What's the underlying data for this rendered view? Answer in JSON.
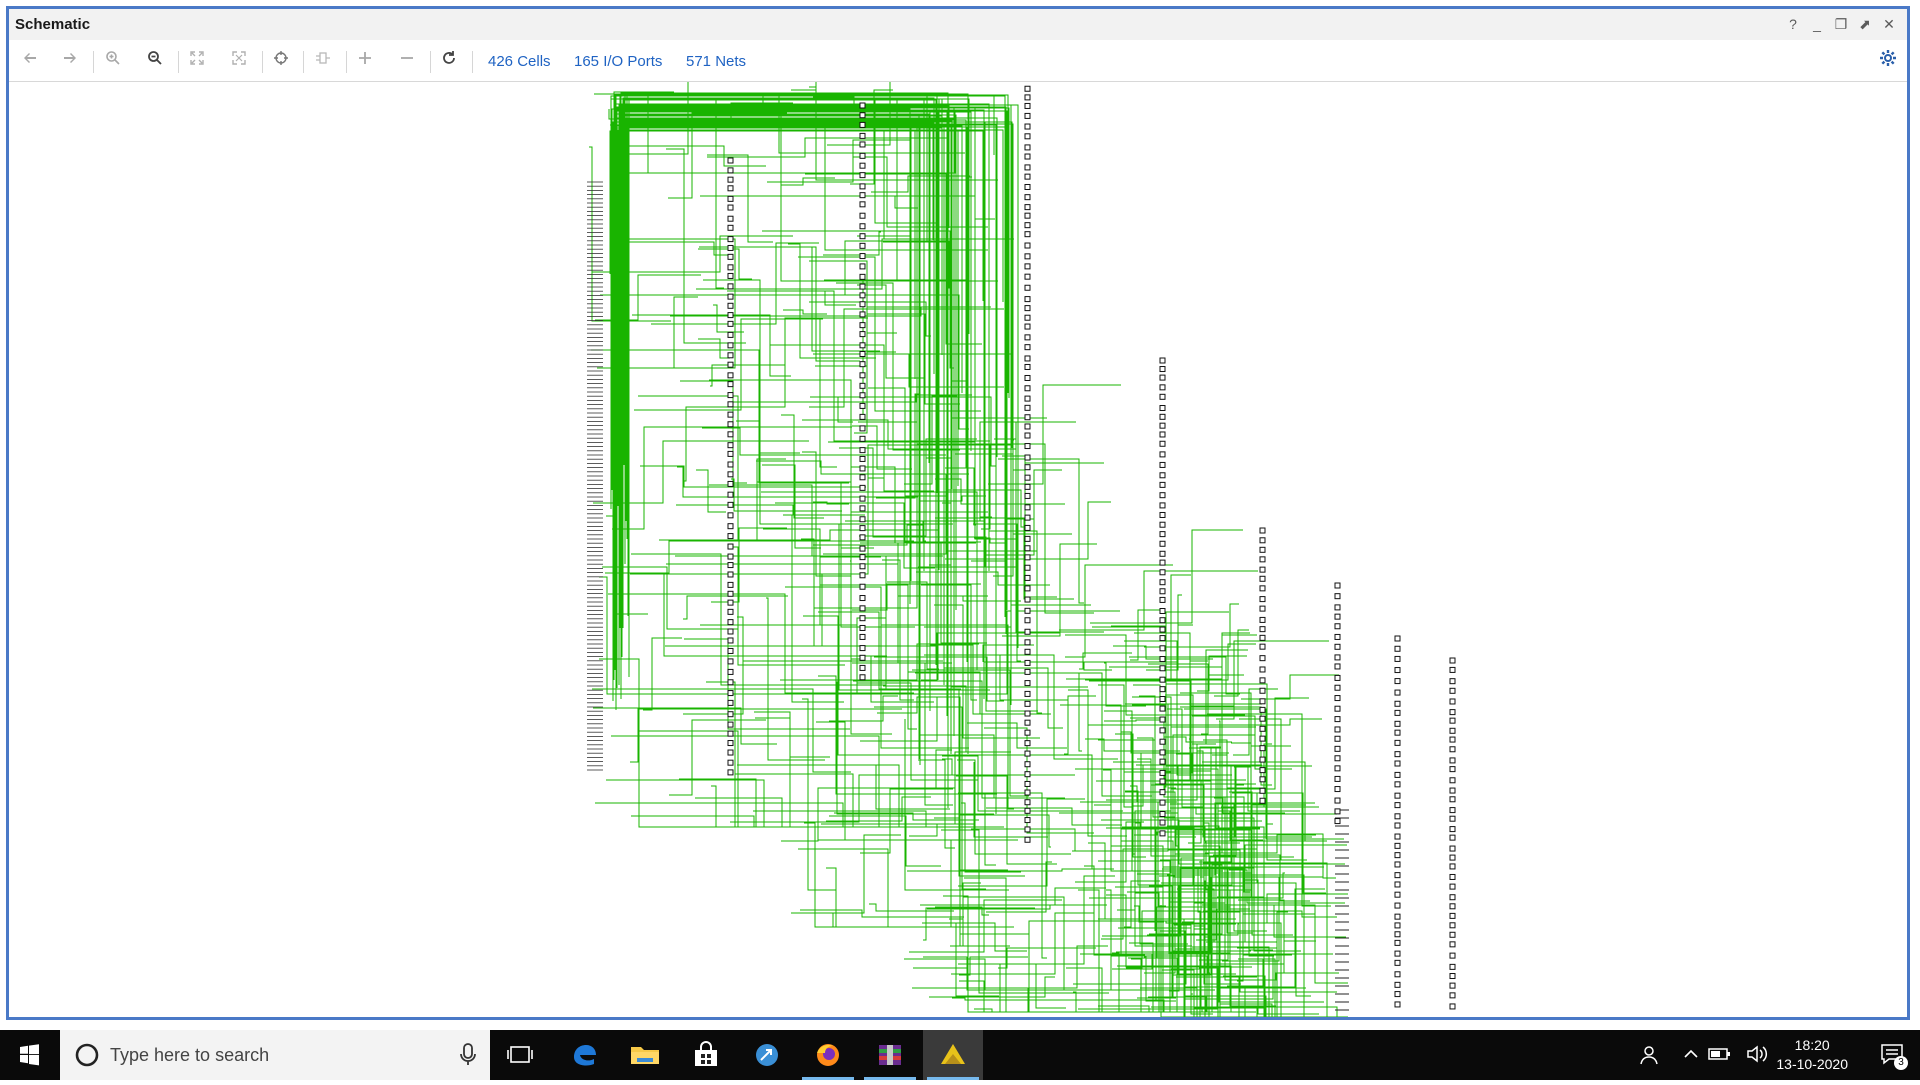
{
  "window": {
    "title": "Schematic",
    "controls": [
      "?",
      "_",
      "❐",
      "⬈",
      "✕"
    ]
  },
  "toolbar": {
    "cells": "426 Cells",
    "io_ports": "165 I/O Ports",
    "nets": "571 Nets"
  },
  "taskbar": {
    "search_placeholder": "Type here to search",
    "time": "18:20",
    "date": "13-10-2020",
    "notification_count": "3"
  },
  "colors": {
    "wire": "#19b400",
    "frame": "#4a79c7",
    "link": "#1f63c3"
  }
}
